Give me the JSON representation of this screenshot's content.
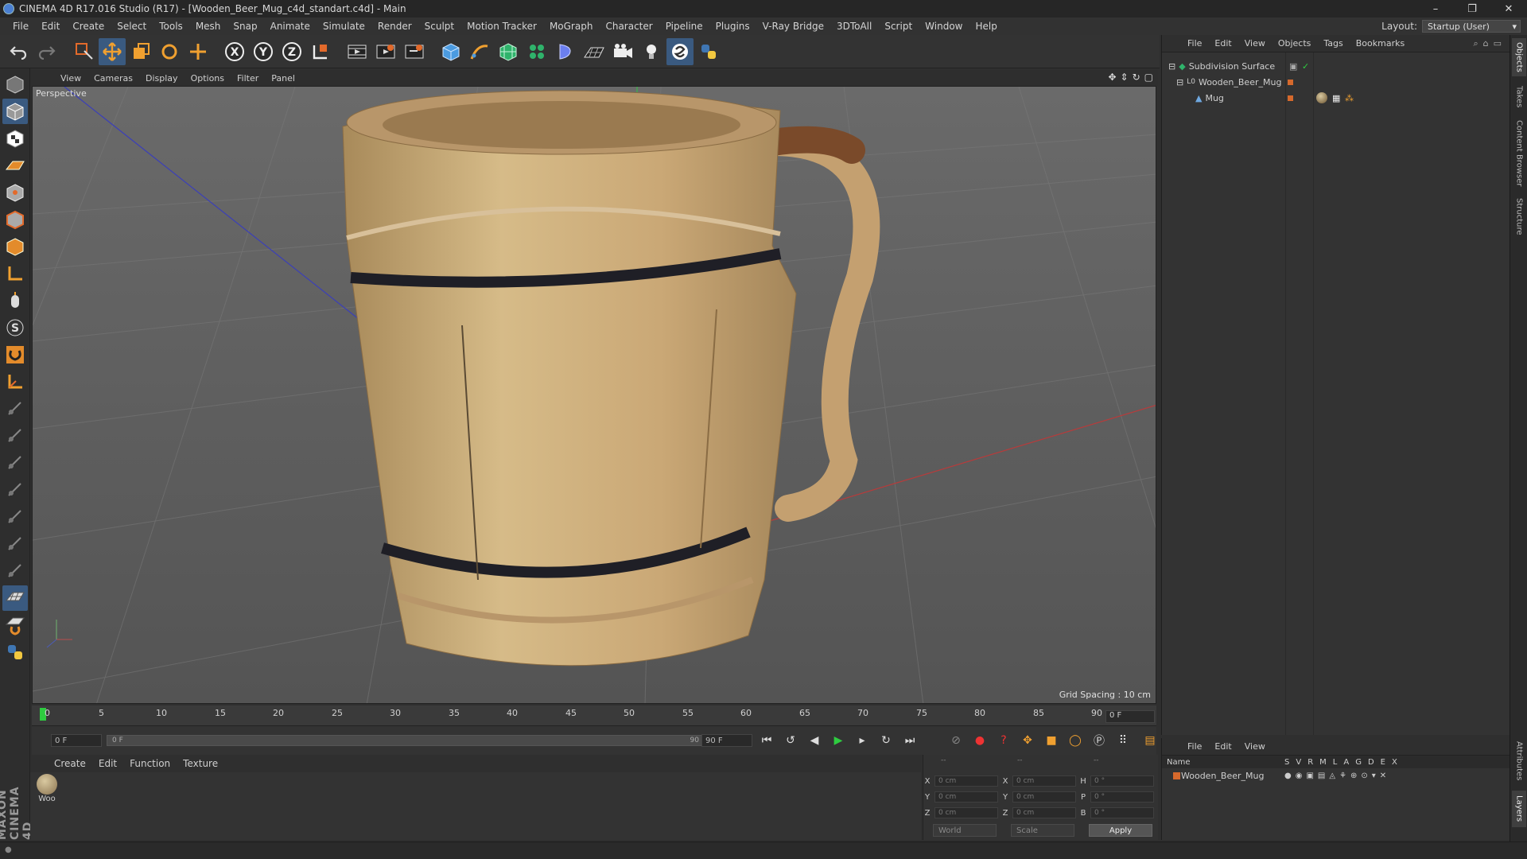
{
  "title": "CINEMA 4D R17.016 Studio (R17) - [Wooden_Beer_Mug_c4d_standart.c4d] - Main",
  "window_controls": [
    "–",
    "❐",
    "✕"
  ],
  "menu": [
    "File",
    "Edit",
    "Create",
    "Select",
    "Tools",
    "Mesh",
    "Snap",
    "Animate",
    "Simulate",
    "Render",
    "Sculpt",
    "Motion Tracker",
    "MoGraph",
    "Character",
    "Pipeline",
    "Plugins",
    "V-Ray Bridge",
    "3DToAll",
    "Script",
    "Window",
    "Help"
  ],
  "layout_label": "Layout:",
  "layout_value": "Startup (User)",
  "toolbar_icons": [
    "undo-icon",
    "redo-icon",
    "live-select-icon",
    "move-icon",
    "scale-icon",
    "rotate-icon",
    "recent-tool-icon",
    "x-axis-icon",
    "y-axis-icon",
    "z-axis-icon",
    "world-coord-icon",
    "render-view-icon",
    "render-picture-viewer-icon",
    "render-settings-icon",
    "cube-icon",
    "pen-icon",
    "subdivision-icon",
    "cloner-icon",
    "deformer-icon",
    "floor-icon",
    "camera-icon",
    "light-icon",
    "script-icon",
    "python-icon"
  ],
  "viewport": {
    "menu": [
      "View",
      "Cameras",
      "Display",
      "Options",
      "Filter",
      "Panel"
    ],
    "label": "Perspective",
    "grid_spacing": "Grid Spacing : 10 cm"
  },
  "timeline": {
    "ticks": [
      "0",
      "5",
      "10",
      "15",
      "20",
      "25",
      "30",
      "35",
      "40",
      "45",
      "50",
      "55",
      "60",
      "65",
      "70",
      "75",
      "80",
      "85",
      "90"
    ],
    "current_frame": "0 F",
    "start_field": "0 F",
    "slider_start": "0 F",
    "slider_end": "90 F",
    "end_field": "90 F"
  },
  "material_manager": {
    "menu": [
      "Create",
      "Edit",
      "Function",
      "Texture"
    ],
    "material_name": "Woo"
  },
  "coordinates": {
    "header": [
      "--",
      "--",
      "--"
    ],
    "rows": [
      {
        "a": "X",
        "av": "0 cm",
        "b": "X",
        "bv": "0 cm",
        "c": "H",
        "cv": "0 °"
      },
      {
        "a": "Y",
        "av": "0 cm",
        "b": "Y",
        "bv": "0 cm",
        "c": "P",
        "cv": "0 °"
      },
      {
        "a": "Z",
        "av": "0 cm",
        "b": "Z",
        "bv": "0 cm",
        "c": "B",
        "cv": "0 °"
      }
    ],
    "mode": "World",
    "scale": "Scale",
    "apply": "Apply"
  },
  "object_manager": {
    "menu": [
      "File",
      "Edit",
      "View",
      "Objects",
      "Tags",
      "Bookmarks"
    ],
    "objects": [
      {
        "name": "Subdivision Surface",
        "indent": 0
      },
      {
        "name": "Wooden_Beer_Mug",
        "indent": 1
      },
      {
        "name": "Mug",
        "indent": 2
      }
    ]
  },
  "attribute_manager": {
    "menu": [
      "File",
      "Edit",
      "View"
    ],
    "header_name": "Name",
    "columns": [
      "S",
      "V",
      "R",
      "M",
      "L",
      "A",
      "G",
      "D",
      "E",
      "X"
    ],
    "row_name": "Wooden_Beer_Mug"
  },
  "right_tabs": [
    "Objects",
    "Takes",
    "Content Browser",
    "Structure",
    "Attributes",
    "Layers"
  ],
  "maxon_logo": "MAXON CINEMA 4D",
  "colors": {
    "accent": "#3a5a80",
    "object_dot": "#d6692c"
  }
}
